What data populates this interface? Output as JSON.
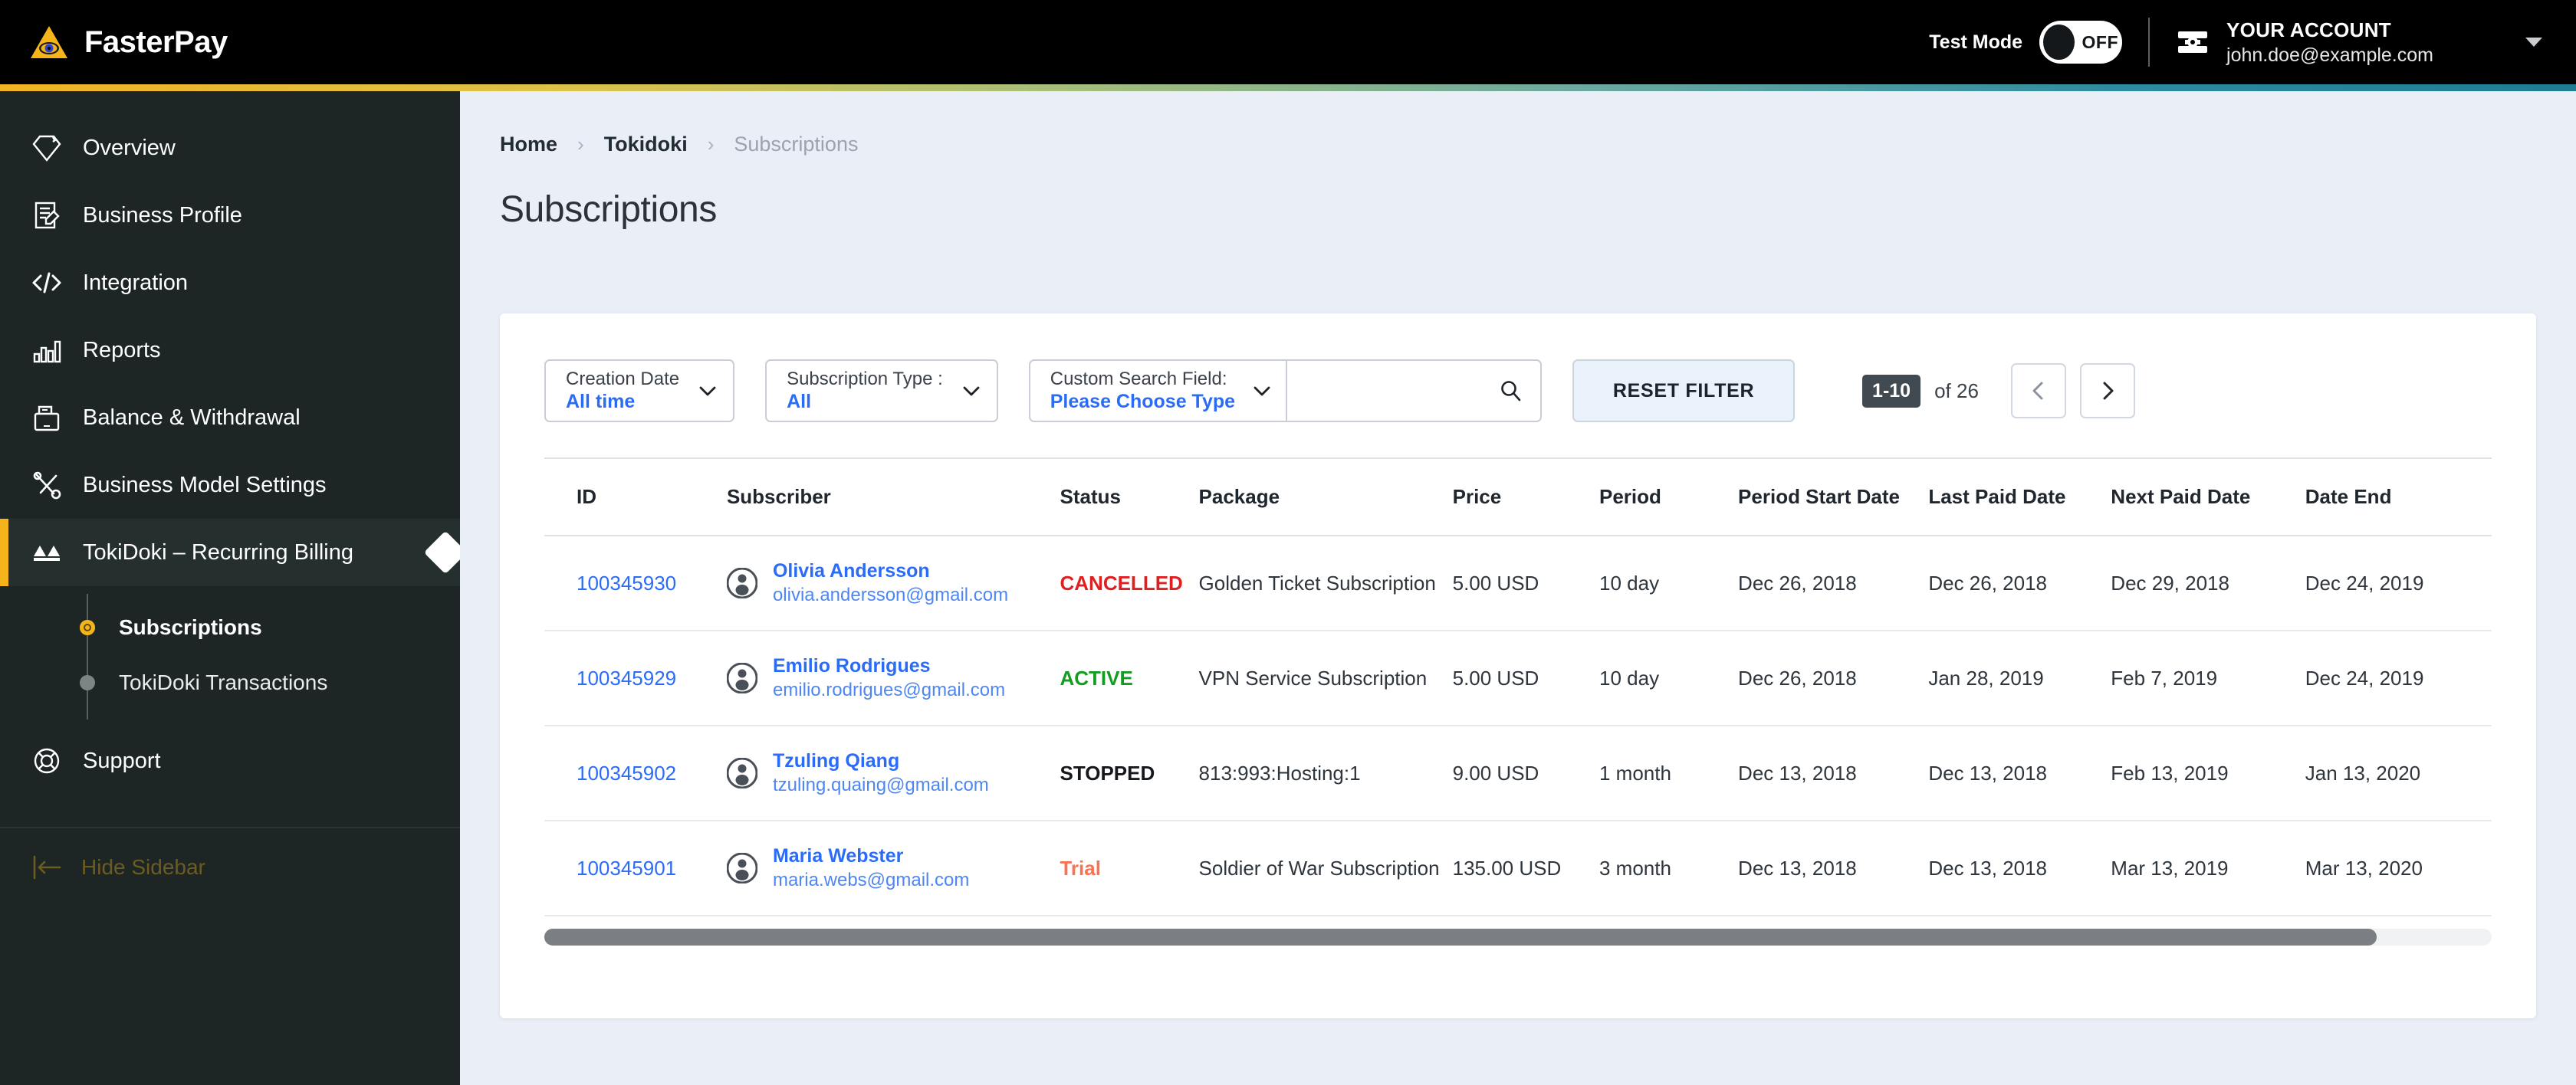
{
  "header": {
    "brand": "FasterPay",
    "brand_logo_icon": "eye-triangle-logo",
    "test_mode_label": "Test Mode",
    "toggle_state": "OFF",
    "account_icon": "account-card-icon",
    "account_title": "YOUR ACCOUNT",
    "account_email": "john.doe@example.com",
    "caret_icon": "chevron-down-icon"
  },
  "sidebar": {
    "items": [
      {
        "label": "Overview",
        "icon": "diamond-icon"
      },
      {
        "label": "Business Profile",
        "icon": "document-edit-icon"
      },
      {
        "label": "Integration",
        "icon": "code-brackets-icon"
      },
      {
        "label": "Reports",
        "icon": "bar-chart-icon"
      },
      {
        "label": "Balance & Withdrawal",
        "icon": "cash-drawer-icon"
      },
      {
        "label": "Business Model Settings",
        "icon": "tools-icon"
      },
      {
        "label": "TokiDoki – Recurring Billing",
        "icon": "tokidoki-icon"
      }
    ],
    "subitems": [
      {
        "label": "Subscriptions"
      },
      {
        "label": "TokiDoki Transactions"
      }
    ],
    "support": {
      "label": "Support",
      "icon": "lifebuoy-icon"
    },
    "hide_sidebar": {
      "label": "Hide Sidebar",
      "icon": "collapse-left-icon"
    }
  },
  "breadcrumb": {
    "home": "Home",
    "section": "Tokidoki",
    "current": "Subscriptions",
    "separator": "›"
  },
  "page": {
    "title": "Subscriptions"
  },
  "filters": {
    "creation_date": {
      "label": "Creation Date",
      "value": "All time"
    },
    "subscription_type": {
      "label": "Subscription Type :",
      "value": "All"
    },
    "custom_search": {
      "label": "Custom Search Field:",
      "value": "Please Choose Type"
    },
    "search_input": {
      "value": "",
      "placeholder": ""
    },
    "search_icon": "search-icon",
    "reset_label": "RESET FILTER"
  },
  "pagination": {
    "range": "1-10",
    "total_text": "of 26",
    "prev_icon": "chevron-left-icon",
    "next_icon": "chevron-right-icon"
  },
  "table": {
    "columns": [
      "ID",
      "Subscriber",
      "Status",
      "Package",
      "Price",
      "Period",
      "Period Start Date",
      "Last Paid Date",
      "Next Paid Date",
      "Date End"
    ],
    "rows": [
      {
        "id": "100345930",
        "name": "Olivia Andersson",
        "email": "olivia.andersson@gmail.com",
        "status": "CANCELLED",
        "status_color": "#e02020",
        "package": "Golden Ticket Subscription",
        "price": "5.00 USD",
        "period": "10 day",
        "period_start": "Dec 26, 2018",
        "last_paid": "Dec 26, 2018",
        "next_paid": "Dec 29, 2018",
        "date_end": "Dec 24, 2019"
      },
      {
        "id": "100345929",
        "name": "Emilio Rodrigues",
        "email": "emilio.rodrigues@gmail.com",
        "status": "ACTIVE",
        "status_color": "#139c1f",
        "package": "VPN Service Subscription",
        "price": "5.00 USD",
        "period": "10 day",
        "period_start": "Dec 26, 2018",
        "last_paid": "Jan 28, 2019",
        "next_paid": "Feb 7, 2019",
        "date_end": "Dec 24, 2019"
      },
      {
        "id": "100345902",
        "name": "Tzuling Qiang",
        "email": "tzuling.quaing@gmail.com",
        "status": "STOPPED",
        "status_color": "#15191d",
        "package": "813:993:Hosting:1",
        "price": "9.00 USD",
        "period": "1 month",
        "period_start": "Dec 13, 2018",
        "last_paid": "Dec 13, 2018",
        "next_paid": "Feb 13, 2019",
        "date_end": "Jan 13, 2020"
      },
      {
        "id": "100345901",
        "name": "Maria Webster",
        "email": "maria.webs@gmail.com",
        "status": "Trial",
        "status_color": "#f97352",
        "package": "Soldier of War Subscription",
        "price": "135.00 USD",
        "period": "3 month",
        "period_start": "Dec 13, 2018",
        "last_paid": "Dec 13, 2018",
        "next_paid": "Mar 13, 2019",
        "date_end": "Mar 13, 2020"
      }
    ]
  },
  "colors": {
    "brand_yellow": "#f5b51a",
    "accent_blue": "#2b6cf6",
    "sidebar_bg": "#1d2625",
    "page_bg": "#eaeff7"
  }
}
